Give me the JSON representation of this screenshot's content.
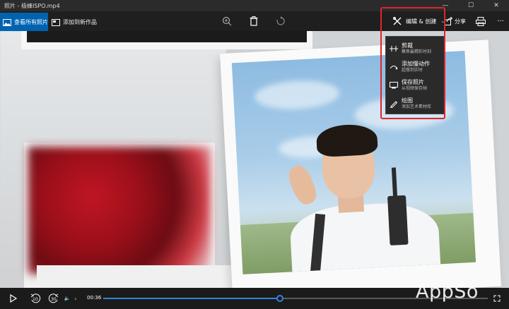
{
  "window": {
    "title": "照片 - 极蜂ISPO.mp4",
    "controls": {
      "minimize": "—",
      "maximize": "☐",
      "close": "✕"
    }
  },
  "toolbar": {
    "view_all_label": "查看所有照片",
    "add_new_label": "添加到新作品",
    "zoom_icon": "zoom-in-icon",
    "delete_icon": "delete-icon",
    "rotate_icon": "rotate-icon",
    "edit_create_label": "编辑 & 创建",
    "share_label": "分享",
    "print_icon": "print-icon",
    "more_label": "···"
  },
  "edit_menu": {
    "items": [
      {
        "label": "剪裁",
        "sub": "聚焦最精彩时刻",
        "icon": "trim-icon"
      },
      {
        "label": "添加慢动作",
        "sub": "超慢到实时",
        "icon": "slow-motion-icon"
      },
      {
        "label": "保存照片",
        "sub": "从视频保存帧",
        "icon": "save-photo-icon"
      },
      {
        "label": "绘图",
        "sub": "添加艺术素材库",
        "icon": "draw-icon"
      }
    ]
  },
  "player": {
    "time": "00:36",
    "progress_fraction": 0.46,
    "rewind_label": "10",
    "forward_label": "30"
  },
  "watermark": "AppSo",
  "colors": {
    "accent": "#0063b1",
    "highlight": "#e0242b",
    "progress": "#2f86d8"
  }
}
